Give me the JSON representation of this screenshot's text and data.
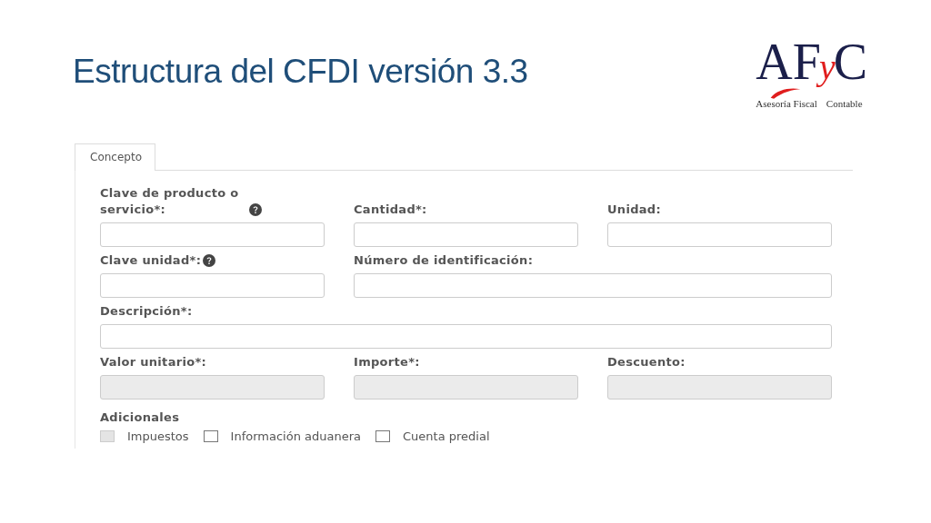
{
  "slide_title": "Estructura del CFDI versión 3.3",
  "logo": {
    "letters_left": "AF",
    "letter_middle": "y",
    "letter_right": "C",
    "tagline_left": "Asesoría Fiscal",
    "tagline_right": "Contable"
  },
  "tabs": [
    {
      "label": "Concepto",
      "selected": true
    }
  ],
  "form_rows": [
    [
      {
        "label": "Clave de producto o servicio*:",
        "help": true,
        "disabled": false
      },
      {
        "label": "Cantidad*:",
        "help": false,
        "disabled": false
      },
      {
        "label": "Unidad:",
        "help": false,
        "disabled": false
      }
    ],
    [
      {
        "label": "Clave unidad*:",
        "help": true,
        "disabled": false
      },
      {
        "label": "Número de identificación:",
        "help": false,
        "disabled": false
      }
    ],
    [
      {
        "label": "Descripción*:",
        "help": false,
        "disabled": false
      }
    ],
    [
      {
        "label": "Valor unitario*:",
        "help": false,
        "disabled": true
      },
      {
        "label": "Importe*:",
        "help": false,
        "disabled": true
      },
      {
        "label": "Descuento:",
        "help": false,
        "disabled": true
      }
    ]
  ],
  "additional": {
    "title": "Adicionales",
    "options": [
      {
        "label": "Impuestos",
        "checked": false,
        "disabled": true
      },
      {
        "label": "Información aduanera",
        "checked": false,
        "disabled": false
      },
      {
        "label": "Cuenta predial",
        "checked": false,
        "disabled": false
      }
    ]
  }
}
